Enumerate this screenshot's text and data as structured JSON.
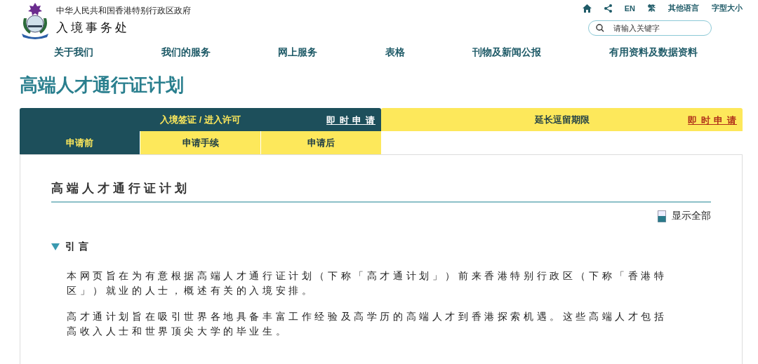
{
  "header": {
    "government": "中华人民共和国香港特别行政区政府",
    "department": "入境事务处"
  },
  "top_links": [
    {
      "kind": "home"
    },
    {
      "kind": "share"
    },
    {
      "kind": "text",
      "label": "EN"
    },
    {
      "kind": "text",
      "label": "繁"
    },
    {
      "kind": "text",
      "label": "其他语言"
    },
    {
      "kind": "text",
      "label": "字型大小"
    }
  ],
  "search": {
    "placeholder": "请输入关键字"
  },
  "nav": [
    "关于我们",
    "我们的服务",
    "网上服务",
    "表格",
    "刊物及新闻公报",
    "有用资料及数据资料"
  ],
  "page_title": "高端人才通行证计划",
  "tabs": [
    {
      "label": "入境签证 / 进入许可",
      "link": "即 时 申 请",
      "selected": true
    },
    {
      "label": "延长逗留期限",
      "link": "即 时 申 请",
      "selected": false
    }
  ],
  "subtabs": [
    {
      "label": "申请前",
      "selected": true
    },
    {
      "label": "申请手续",
      "selected": false
    },
    {
      "label": "申请后",
      "selected": false
    }
  ],
  "content": {
    "heading": "高端人才通行证计划",
    "show_all": "显示全部",
    "sections": [
      {
        "title": "引言",
        "expanded": true,
        "paragraphs": [
          "本网页旨在为有意根据高端人才通行证计划（下称「高才通计划」）前来香港特别行政区（下称「香港特区」）就业的人士，概述有关的入境安排。",
          "高才通计划旨在吸引世界各地具备丰富工作经验及高学历的高端人才到香港探索机遇。这些高端人才包括高收入人士和世界顶尖大学的毕业生。"
        ]
      }
    ]
  }
}
